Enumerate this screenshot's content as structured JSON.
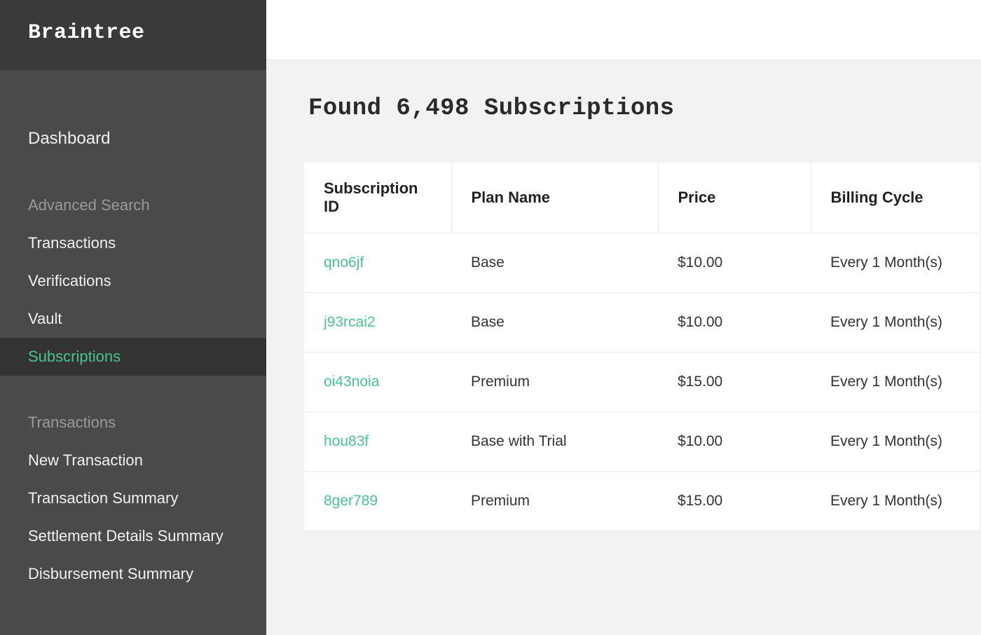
{
  "brand": "Braintree",
  "sidebar": {
    "dashboard": "Dashboard",
    "section_advanced": "Advanced Search",
    "advanced_items": [
      {
        "label": "Transactions",
        "active": false
      },
      {
        "label": "Verifications",
        "active": false
      },
      {
        "label": "Vault",
        "active": false
      },
      {
        "label": "Subscriptions",
        "active": true
      }
    ],
    "section_transactions": "Transactions",
    "transactions_items": [
      {
        "label": "New Transaction"
      },
      {
        "label": "Transaction Summary"
      },
      {
        "label": "Settlement Details Summary"
      },
      {
        "label": "Disbursement Summary"
      }
    ]
  },
  "main": {
    "title": "Found 6,498 Subscriptions",
    "columns": {
      "id": "Subscription ID",
      "plan": "Plan Name",
      "price": "Price",
      "cycle": "Billing Cycle"
    },
    "rows": [
      {
        "id": "qno6jf",
        "plan": "Base",
        "price": "$10.00",
        "cycle": "Every 1 Month(s)"
      },
      {
        "id": "j93rcai2",
        "plan": "Base",
        "price": "$10.00",
        "cycle": "Every 1 Month(s)"
      },
      {
        "id": "oi43noia",
        "plan": "Premium",
        "price": "$15.00",
        "cycle": "Every 1 Month(s)"
      },
      {
        "id": "hou83f",
        "plan": "Base with Trial",
        "price": "$10.00",
        "cycle": "Every 1 Month(s)"
      },
      {
        "id": "8ger789",
        "plan": "Premium",
        "price": "$15.00",
        "cycle": "Every 1 Month(s)"
      }
    ]
  }
}
